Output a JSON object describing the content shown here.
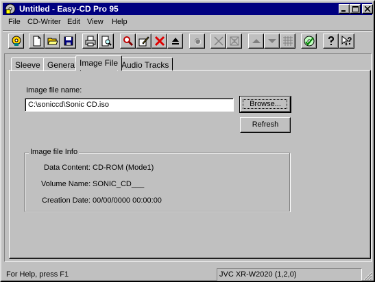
{
  "window": {
    "title": "Untitled - Easy-CD Pro 95",
    "app_icon": "easy-cd-app-icon",
    "controls": [
      "minimize-icon",
      "maximize-icon",
      "close-icon"
    ]
  },
  "menu": {
    "items": [
      "File",
      "CD-Writer",
      "Edit",
      "View",
      "Help"
    ]
  },
  "toolbar": {
    "buttons": [
      {
        "icon": "cd-user-icon",
        "enabled": true
      },
      {
        "icon": "new-document-icon",
        "enabled": true
      },
      {
        "icon": "open-folder-icon",
        "enabled": true
      },
      {
        "icon": "save-disk-icon",
        "enabled": true
      },
      {
        "icon": "print-icon",
        "enabled": true
      },
      {
        "icon": "print-preview-icon",
        "enabled": true
      },
      {
        "icon": "find-icon",
        "enabled": true
      },
      {
        "icon": "edit-properties-icon",
        "enabled": true
      },
      {
        "icon": "delete-x-icon",
        "enabled": true
      },
      {
        "icon": "eject-icon",
        "enabled": true
      },
      {
        "icon": "record-icon",
        "enabled": false
      },
      {
        "icon": "cancel-x-icon",
        "enabled": false
      },
      {
        "icon": "layout-icon",
        "enabled": false
      },
      {
        "icon": "move-up-icon",
        "enabled": false
      },
      {
        "icon": "move-down-icon",
        "enabled": false
      },
      {
        "icon": "grid-icon",
        "enabled": false
      },
      {
        "icon": "cd-check-icon",
        "enabled": true
      },
      {
        "icon": "help-icon",
        "enabled": true
      },
      {
        "icon": "context-help-icon",
        "enabled": true
      }
    ]
  },
  "tabs": [
    {
      "label": "Sleeve",
      "active": false
    },
    {
      "label": "General",
      "active": false
    },
    {
      "label": "Image File",
      "active": true
    },
    {
      "label": "Audio Tracks",
      "active": false
    }
  ],
  "image_file": {
    "name_label": "Image file name:",
    "name_value": "C:\\soniccd\\Sonic CD.iso",
    "browse_label": "Browse...",
    "refresh_label": "Refresh"
  },
  "info": {
    "group_title": "Image file Info",
    "rows": [
      {
        "label": "Data Content:",
        "value": "CD-ROM (Mode1)"
      },
      {
        "label": "Volume Name:",
        "value": "SONIC_CD___"
      },
      {
        "label": "Creation Date:",
        "value": "00/00/0000 00:00:00"
      }
    ]
  },
  "status": {
    "help_text": "For Help, press F1",
    "device": "JVC XR-W2020 (1,2,0)"
  },
  "colors": {
    "face": "#c0c0c0",
    "title_bar": "#000080",
    "highlight": "#ffffff",
    "shadow": "#808080"
  }
}
